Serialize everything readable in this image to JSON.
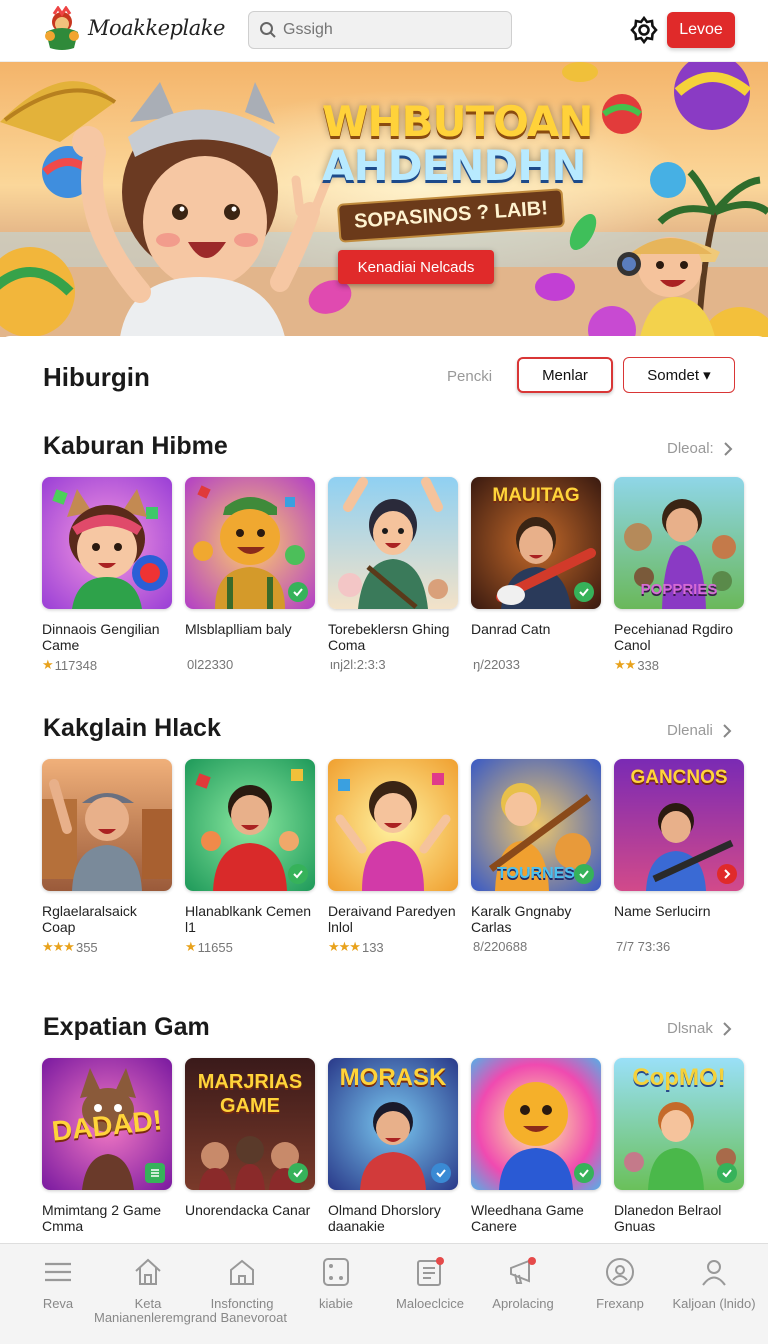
{
  "header": {
    "brand": "Moakkeplake",
    "search_placeholder": "Gssigh",
    "login_label": "Levoe"
  },
  "hero": {
    "title_line1": "WHBUTOAN",
    "title_line2": "AHDENDHN",
    "subtitle": "SOPASINOS ? LAIB!",
    "cta_label": "Kenadiai Nelcads"
  },
  "page": {
    "title": "Hiburgin",
    "filter_label": "Pencki",
    "filter_active": "Menlar",
    "sort_label": "Somdet ▾"
  },
  "sections": [
    {
      "title": "Kaburan Hibme",
      "see_all": "Dleoal:",
      "items": [
        {
          "name": "Dinnaois Gengilian Came",
          "stars": "★",
          "meta": "117348",
          "badge": ""
        },
        {
          "name": "Mlsblaplliam baly",
          "stars": "",
          "meta": "0l22330",
          "badge": "check"
        },
        {
          "name": "Torebeklersn Ghing Coma",
          "stars": "",
          "meta": "ιnj2l:2:3:3",
          "badge": ""
        },
        {
          "name": "Danrad Catn",
          "stars": "",
          "meta": "ŋ/22033",
          "badge": "check"
        },
        {
          "name": "Pecehianad Rgdiro Canol",
          "stars": "★★",
          "meta": "338",
          "badge": ""
        }
      ]
    },
    {
      "title": "Kakglain Hlack",
      "see_all": "Dlenali",
      "items": [
        {
          "name": "Rglaelaralsaick Coap",
          "stars": "★★★",
          "meta": "355",
          "badge": ""
        },
        {
          "name": "Hlanablkank Cemen l1",
          "stars": "★",
          "meta": "11655",
          "badge": "check"
        },
        {
          "name": "Deraivand Paredyen lnlol",
          "stars": "★★★",
          "meta": "133",
          "badge": ""
        },
        {
          "name": "Karalk Gngnaby Carlas",
          "stars": "",
          "meta": "8/220688",
          "badge": "check"
        },
        {
          "name": "Name Serlucirn",
          "stars": "",
          "meta": "7/7 73:36",
          "badge": "next"
        }
      ]
    },
    {
      "title": "Expatian Gam",
      "see_all": "Dlsnak",
      "items": [
        {
          "name": "Mmimtang 2 Game Cmma",
          "stars": "",
          "meta": "",
          "badge": "list"
        },
        {
          "name": "Unorendacka Canar",
          "stars": "",
          "meta": "",
          "badge": "check"
        },
        {
          "name": "Olmand Dhorslory daanakie",
          "stars": "",
          "meta": "",
          "badge": "blue"
        },
        {
          "name": "Wleedhana Game Canere",
          "stars": "",
          "meta": "",
          "badge": "check"
        },
        {
          "name": "Dlanedon Belraol Gnuas",
          "stars": "",
          "meta": "",
          "badge": "check"
        }
      ]
    }
  ],
  "thumb_texts": {
    "s1_4": "MAUITAG",
    "s1_5": "POPPRIES",
    "s2_4": "TOURNES",
    "s2_5": "GANCNOS",
    "s3_1": "DADAD!",
    "s3_2_l1": "MARJRIAS",
    "s3_2_l2": "GAME",
    "s3_3": "MORASK",
    "s3_5": "CopMO!"
  },
  "bottom_nav": {
    "items": [
      {
        "label": "Reva",
        "icon": "menu-icon"
      },
      {
        "label": "Keta",
        "icon": "home-icon"
      },
      {
        "label": "Insfoncting",
        "icon": "house-outline-icon"
      },
      {
        "label": "kiabie",
        "icon": "dice-icon"
      },
      {
        "label": "Maloeclcice",
        "icon": "clipboard-icon"
      },
      {
        "label": "Aprolacing",
        "icon": "megaphone-icon"
      },
      {
        "label": "Frexanp",
        "icon": "circle-user-icon"
      },
      {
        "label": "Kaljoan (lnido)",
        "icon": "user-icon"
      }
    ],
    "sub_text": "Manianenleremgrand Banevoroat"
  },
  "colors": {
    "accent": "#e02a2a",
    "star": "#e8a21c",
    "check_badge": "#36b25a"
  }
}
